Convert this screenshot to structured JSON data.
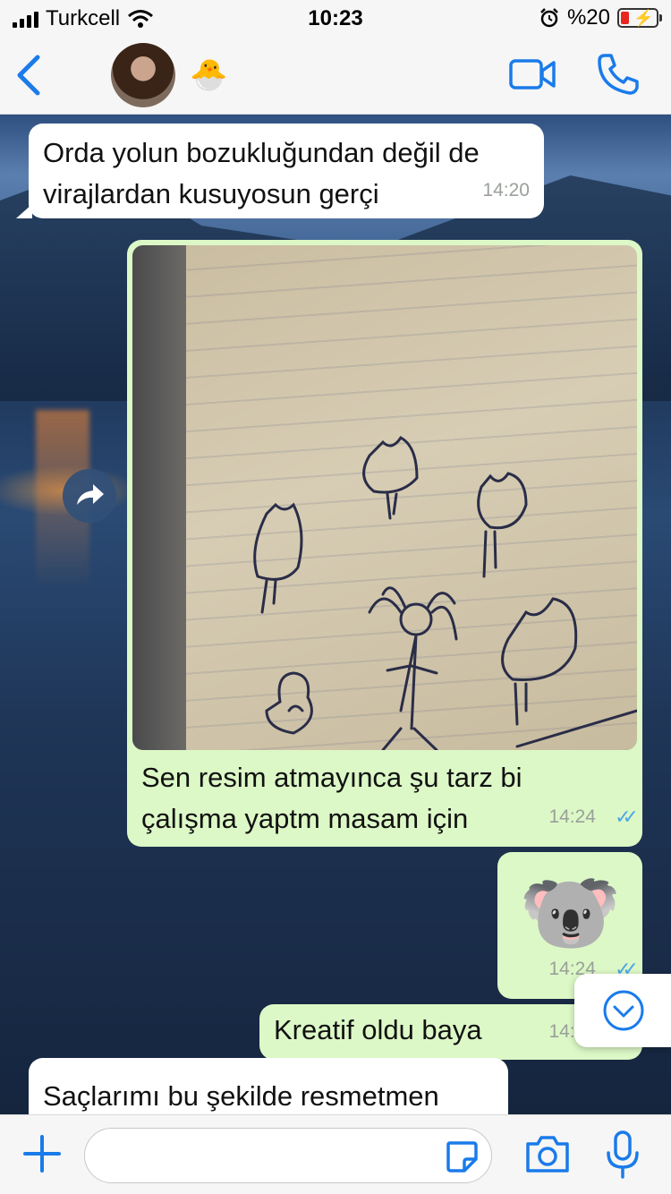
{
  "status_bar": {
    "carrier": "Turkcell",
    "time": "10:23",
    "battery": "%20"
  },
  "header": {
    "contact_emoji": "🐣"
  },
  "messages": [
    {
      "direction": "incoming",
      "text": "Orda yolun bozukluğundan değil de virajlardan kusuyosun gerçi",
      "time": "14:20"
    },
    {
      "direction": "outgoing",
      "type": "photo",
      "caption": "Sen resim atmayınca şu tarz bi çalışma yaptm masam için",
      "time": "14:24",
      "status": "read"
    },
    {
      "direction": "outgoing",
      "type": "sticker",
      "emoji": "🐨",
      "time": "14:24",
      "status": "read"
    },
    {
      "direction": "outgoing",
      "text": "Kreatif oldu baya",
      "time": "14:24",
      "status": "read"
    },
    {
      "direction": "incoming",
      "text": "Saçlarımı bu şekilde resmetmen"
    }
  ],
  "input": {
    "placeholder": ""
  },
  "colors": {
    "accent": "#1a7bea",
    "outgoing_bubble": "#dcf8c6",
    "incoming_bubble": "#ffffff",
    "read_ticks": "#4fa7e6"
  },
  "icons": [
    "back-chevron-icon",
    "video-call-icon",
    "voice-call-icon",
    "forward-icon",
    "scroll-down-icon",
    "plus-icon",
    "sticker-icon",
    "camera-icon",
    "microphone-icon",
    "wifi-icon",
    "alarm-icon"
  ]
}
